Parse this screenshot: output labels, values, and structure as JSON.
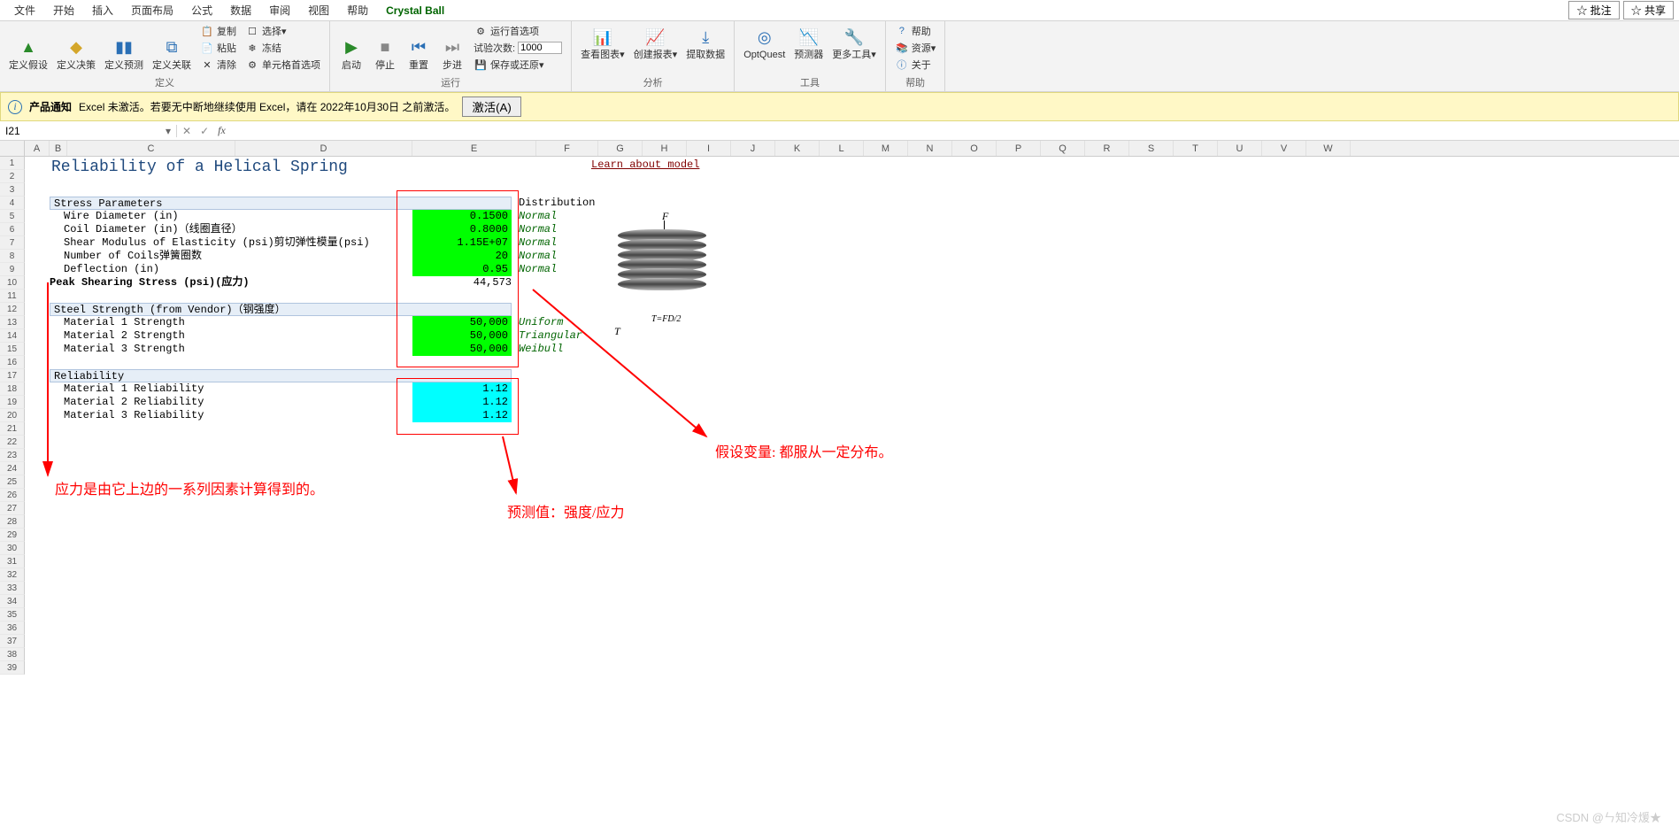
{
  "menu": {
    "tabs": [
      "文件",
      "开始",
      "插入",
      "页面布局",
      "公式",
      "数据",
      "审阅",
      "视图",
      "帮助",
      "Crystal Ball"
    ],
    "right": [
      "☆ 批注",
      "☆ 共享"
    ]
  },
  "ribbon": {
    "define": {
      "label": "定义",
      "btns": [
        "定义假设",
        "定义决策",
        "定义预测",
        "定义关联"
      ],
      "side": [
        "复制",
        "粘贴",
        "清除",
        "选择▾",
        "冻结",
        "单元格首选项"
      ]
    },
    "run": {
      "label": "运行",
      "btns": [
        "启动",
        "停止",
        "重置",
        "步进"
      ],
      "side": {
        "pref": "运行首选项",
        "trials_label": "试验次数:",
        "trials": "1000",
        "save": "保存或还原▾"
      }
    },
    "analyze": {
      "label": "分析",
      "btns": [
        "查看图表▾",
        "创建报表▾",
        "提取数据"
      ]
    },
    "tools": {
      "label": "工具",
      "btns": [
        "OptQuest",
        "预测器",
        "更多工具▾"
      ]
    },
    "help": {
      "label": "帮助",
      "side": [
        "帮助",
        "资源▾",
        "关于"
      ]
    }
  },
  "msgbar": {
    "title": "产品通知",
    "text": "Excel 未激活。若要无中断地继续使用 Excel，请在 2022年10月30日 之前激活。",
    "btn": "激活(A)"
  },
  "namebox": "I21",
  "columns": [
    "A",
    "B",
    "C",
    "D",
    "E",
    "F",
    "G",
    "H",
    "I",
    "J",
    "K",
    "L",
    "M",
    "N",
    "O",
    "P",
    "Q",
    "R",
    "S",
    "T",
    "U",
    "V",
    "W"
  ],
  "widths": [
    28,
    20,
    190,
    200,
    140,
    70,
    50,
    50,
    50,
    50,
    50,
    50,
    50,
    50,
    50,
    50,
    50,
    50,
    50,
    50,
    50,
    50,
    50
  ],
  "title": "Reliability of a Helical Spring",
  "link": "Learn about model",
  "sections": {
    "stress": "Stress Parameters",
    "steel": "Steel Strength (from Vendor)（钢强度）",
    "rel": "Reliability"
  },
  "distHdr": "Distribution",
  "rows": {
    "r5": {
      "label": "Wire Diameter (in)",
      "val": "0.1500",
      "dist": "Normal"
    },
    "r6": {
      "label": "Coil Diameter (in)（线圈直径）",
      "val": "0.8000",
      "dist": "Normal"
    },
    "r7": {
      "label": "Shear Modulus of Elasticity (psi)剪切弹性模量(psi)",
      "val": "1.15E+07",
      "dist": "Normal"
    },
    "r8": {
      "label": "Number of Coils弹簧圈数",
      "val": "20",
      "dist": "Normal"
    },
    "r9": {
      "label": "Deflection (in)",
      "val": "0.95",
      "dist": "Normal"
    },
    "r10": {
      "label": "Peak Shearing Stress (psi)(应力)",
      "val": "44,573"
    },
    "r13": {
      "label": "Material 1 Strength",
      "val": "50,000",
      "dist": "Uniform"
    },
    "r14": {
      "label": "Material 2 Strength",
      "val": "50,000",
      "dist": "Triangular"
    },
    "r15": {
      "label": "Material 3 Strength",
      "val": "50,000",
      "dist": "Weibull"
    },
    "r18": {
      "label": "Material 1 Reliability",
      "val": "1.12"
    },
    "r19": {
      "label": "Material 2 Reliability",
      "val": "1.12"
    },
    "r20": {
      "label": "Material 3 Reliability",
      "val": "1.12"
    }
  },
  "annotations": {
    "a1": "应力是由它上边的一系列因素计算得到的。",
    "a2": "预测值：强度/应力",
    "a3": "假设变量: 都服从一定分布。"
  },
  "spring": {
    "F": "F",
    "T": "T",
    "eq": "T=FD/2"
  },
  "watermark": "CSDN @ㄣ知冷煖★"
}
